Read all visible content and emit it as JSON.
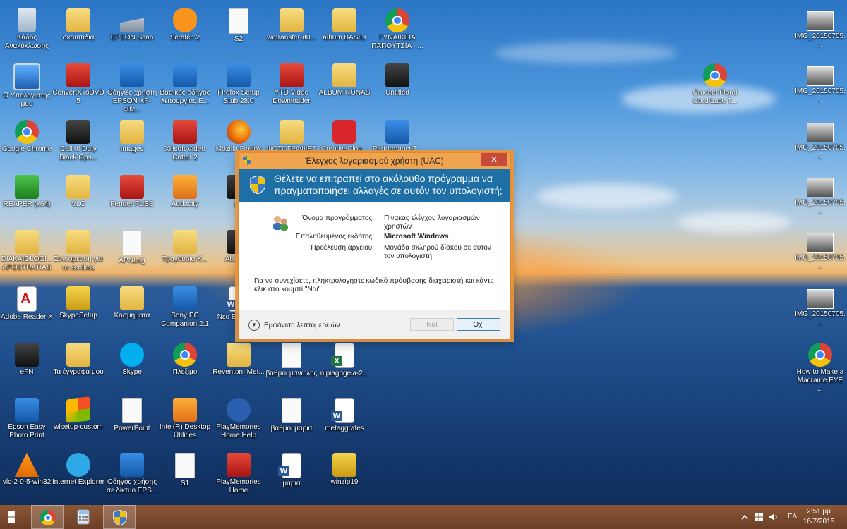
{
  "desktop_icons": [
    {
      "label": "Κάδος Ανακύκλωσης",
      "icon": "recycle-bin-icon",
      "cls": "g-bin"
    },
    {
      "label": "σκουπιδια",
      "icon": "folder-icon",
      "cls": "g-folder"
    },
    {
      "label": "EPSON Scan",
      "icon": "scanner-icon",
      "cls": "g-scan"
    },
    {
      "label": "Scratch 2",
      "icon": "scratch-cat-icon",
      "cls": "g-cat"
    },
    {
      "label": "S2",
      "icon": "document-icon",
      "cls": "g-doc"
    },
    {
      "label": "wetransfer-d0...",
      "icon": "folder-icon",
      "cls": "g-folder"
    },
    {
      "label": "album BASILI",
      "icon": "folder-icon",
      "cls": "g-folder"
    },
    {
      "label": "ΓΥΝΑΙΚΕΙΑ ΠΑΠΟΥΤΣΙΑ - ...",
      "icon": "chrome-icon",
      "cls": "g-chrome"
    },
    {
      "label": "Ο Υπολογιστής μου",
      "icon": "computer-icon",
      "cls": "g-pc"
    },
    {
      "label": "ConvertXToDVD 5",
      "icon": "convertxtodvd-icon",
      "cls": "g-red"
    },
    {
      "label": "Οδηγίες χρήστη EPSON XP-402...",
      "icon": "epson-manual-icon",
      "cls": "g-blue"
    },
    {
      "label": "Βασικός οδηγός λειτουργίας E...",
      "icon": "epson-manual-icon",
      "cls": "g-blue"
    },
    {
      "label": "Firefox Setup Stub 28.0",
      "icon": "installer-icon",
      "cls": "g-blue"
    },
    {
      "label": "YTD Video Downloader",
      "icon": "ytd-icon",
      "cls": "g-red"
    },
    {
      "label": "ALBUM NONAS",
      "icon": "folder-icon",
      "cls": "g-folder"
    },
    {
      "label": "Untitled",
      "icon": "video-thumbnail-icon",
      "cls": "g-dark"
    },
    {
      "label": "Google Chrome",
      "icon": "chrome-icon",
      "cls": "g-chrome"
    },
    {
      "label": "Call of Duty Black Ops...",
      "icon": "game-icon",
      "cls": "g-dark"
    },
    {
      "label": "Images",
      "icon": "folder-icon",
      "cls": "g-folder"
    },
    {
      "label": "Xilisoft Video Cutter 2",
      "icon": "scissors-icon",
      "cls": "g-red"
    },
    {
      "label": "Mozilla Firefox",
      "icon": "firefox-icon",
      "cls": "g-ff"
    },
    {
      "label": "ΦΩΤΟΓΡΑΦΙΕΣ",
      "icon": "vlc-folder-icon",
      "cls": "g-folder"
    },
    {
      "label": "CreativeClou...",
      "icon": "creative-cloud-icon",
      "cls": "g-cc"
    },
    {
      "label": "PerformanceT...",
      "icon": "performance-icon",
      "cls": "g-blue"
    },
    {
      "label": "REAPER (x64)",
      "icon": "reaper-icon",
      "cls": "g-green"
    },
    {
      "label": "VLC",
      "icon": "vlc-folder-icon",
      "cls": "g-folder"
    },
    {
      "label": "Fender FUSE",
      "icon": "fender-icon",
      "cls": "g-red"
    },
    {
      "label": "Audacity",
      "icon": "audacity-icon",
      "cls": "g-orange"
    },
    {
      "label": "pe",
      "icon": "app-icon",
      "cls": "g-dark"
    },
    {
      "label": "DIAKAIOLOGI... APOSTRATIAS",
      "icon": "folder-icon",
      "cls": "g-folder"
    },
    {
      "label": "Συντομευση για το xenikos",
      "icon": "folder-icon",
      "cls": "g-folder"
    },
    {
      "label": "APNLog",
      "icon": "document-icon",
      "cls": "g-doc"
    },
    {
      "label": "Τραγούδια-Κ...",
      "icon": "folder-icon",
      "cls": "g-folder"
    },
    {
      "label": "Abletc Li",
      "icon": "app-icon",
      "cls": "g-dark"
    },
    {
      "label": "Adobe Reader X",
      "icon": "pdf-icon",
      "cls": "g-pdf"
    },
    {
      "label": "SkypeSetup",
      "icon": "installer-icon",
      "cls": "g-winzip"
    },
    {
      "label": "Κοσμηματα",
      "icon": "folder-icon",
      "cls": "g-folder"
    },
    {
      "label": "Sony PC Companion 2.1",
      "icon": "phone-icon",
      "cls": "g-blue"
    },
    {
      "label": "Νέο Εγ του M",
      "icon": "word-icon",
      "cls": "g-word"
    },
    {
      "label": "eFN",
      "icon": "efn-icon",
      "cls": "g-dark"
    },
    {
      "label": "Τα έγγραφά μου",
      "icon": "folder-icon",
      "cls": "g-folder"
    },
    {
      "label": "Skype",
      "icon": "skype-icon",
      "cls": "g-skype"
    },
    {
      "label": "Πλεξιμο",
      "icon": "chrome-icon",
      "cls": "g-chrome"
    },
    {
      "label": "Reventon_Met...",
      "icon": "folder-icon",
      "cls": "g-folder"
    },
    {
      "label": "βαθμοι μανωλης",
      "icon": "document-icon",
      "cls": "g-doc"
    },
    {
      "label": "nipiagogeia-2...",
      "icon": "excel-icon",
      "cls": "g-excel"
    },
    {
      "label": "Epson Easy Photo Print",
      "icon": "epson-photo-icon",
      "cls": "g-blue"
    },
    {
      "label": "wlsetup-custom",
      "icon": "windows-flag-icon",
      "cls": "g-winflag"
    },
    {
      "label": "PowerPoint",
      "icon": "document-icon",
      "cls": "g-doc"
    },
    {
      "label": "Intel(R) Desktop Utilities",
      "icon": "gauge-icon",
      "cls": "g-orange"
    },
    {
      "label": "PlayMemories Home Help",
      "icon": "help-icon",
      "cls": "g-help"
    },
    {
      "label": "βαθμοι μαρια",
      "icon": "document-icon",
      "cls": "g-doc"
    },
    {
      "label": "metaggrafes",
      "icon": "word-icon",
      "cls": "g-word"
    },
    {
      "label": "vlc-2-0-5-win32",
      "icon": "vlc-icon",
      "cls": "g-cone"
    },
    {
      "label": "Internet Explorer",
      "icon": "ie-icon",
      "cls": "g-ie"
    },
    {
      "label": "Οδηγός χρήσης σε δίκτυο EPS...",
      "icon": "epson-manual-icon",
      "cls": "g-blue"
    },
    {
      "label": "S1",
      "icon": "document-icon",
      "cls": "g-doc"
    },
    {
      "label": "PlayMemories Home",
      "icon": "playmemories-icon",
      "cls": "g-red"
    },
    {
      "label": "μαρια",
      "icon": "word-icon",
      "cls": "g-word"
    },
    {
      "label": "winzip19",
      "icon": "winzip-icon",
      "cls": "g-winzip"
    },
    {
      "label": "IMG_20150705...",
      "icon": "image-thumbnail-icon",
      "cls": "g-thumb"
    },
    {
      "label": "Crochet Floral Cord Lace T...",
      "icon": "chrome-icon",
      "cls": "g-chrome"
    },
    {
      "label": "IMG_20150705...",
      "icon": "image-thumbnail-icon",
      "cls": "g-thumb"
    },
    {
      "label": "IMG_20150705...",
      "icon": "image-thumbnail-icon",
      "cls": "g-thumb"
    },
    {
      "label": "IMG_20150705...",
      "icon": "image-thumbnail-icon",
      "cls": "g-thumb"
    },
    {
      "label": "IMG_20150705...",
      "icon": "image-thumbnail-icon",
      "cls": "g-thumb"
    },
    {
      "label": "IMG_20150705...",
      "icon": "image-thumbnail-icon",
      "cls": "g-thumb"
    },
    {
      "label": "How to Make a Macrame EYE ...",
      "icon": "chrome-icon",
      "cls": "g-chrome"
    }
  ],
  "uac": {
    "title": "Έλεγχος λογαριασμού χρήστη (UAC)",
    "close": "✕",
    "headline": "Θέλετε να επιτραπεί στο ακόλουθο πρόγραμμα να πραγματοποιήσει αλλαγές σε αυτόν τον υπολογιστή;",
    "program_name_label": "Όνομα προγράμματος:",
    "program_name_value": "Πίνακας ελέγχου λογαριασμών χρηστών",
    "publisher_label": "Επαληθευμένος εκδότης:",
    "publisher_value": "Microsoft Windows",
    "origin_label": "Προέλευση αρχείου:",
    "origin_value": "Μονάδα σκληρού δίσκου σε αυτόν τον υπολογιστή",
    "message": "Για να συνεχίσετε, πληκτρολογήστε κωδικό πρόσβασης διαχειριστή και κάντε κλικ στο κουμπί \"Ναι\".",
    "details_label": "Εμφάνιση λεπτομερειών",
    "yes_label": "Ναι",
    "no_label": "Όχι"
  },
  "taskbar": {
    "language": "ΕΛ",
    "time": "2:51 μμ",
    "date": "16/7/2015"
  }
}
